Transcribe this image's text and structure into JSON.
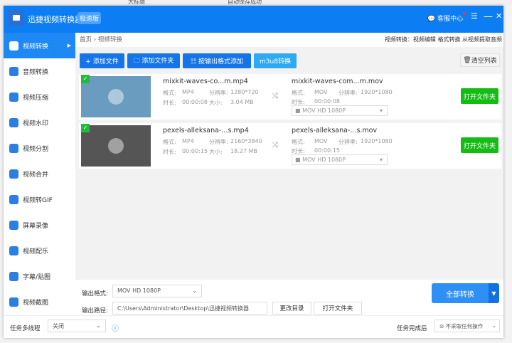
{
  "background": {
    "tab_title": "大标题",
    "autosave": "自动保存成功"
  },
  "app": {
    "title": "迅捷视频转换器",
    "badge": "极速版",
    "service": "客服中心",
    "menu_icon": "☰",
    "min_icon": "—",
    "close_icon": "✕"
  },
  "sidebar": {
    "items": [
      {
        "label": "视频转换"
      },
      {
        "label": "音频转换"
      },
      {
        "label": "视频压缩"
      },
      {
        "label": "视频水印"
      },
      {
        "label": "视频分割"
      },
      {
        "label": "视频合并"
      },
      {
        "label": "视频转GIF"
      },
      {
        "label": "屏幕录像"
      },
      {
        "label": "视频配乐"
      },
      {
        "label": "字幕/贴图"
      },
      {
        "label": "视频截图"
      }
    ]
  },
  "breadcrumb": {
    "home": "首页",
    "sep": "›",
    "current": "视频转换",
    "right": "视频转换：视频编辑 格式转换 从视频提取音频"
  },
  "toolbar": {
    "add_file": "+ 添加文件",
    "add_folder": "🗀 添加文件夹",
    "add_by_format": "☷ 按输出格式添加",
    "m3u8": "m3u8转换",
    "clear": "清空列表"
  },
  "files": [
    {
      "src_name": "mixkit-waves-co...m.mp4",
      "src_format": "MP4",
      "src_res": "1280*720",
      "src_dur": "00:00:08",
      "src_size": "3.04 MB",
      "dst_name": "mixkit-waves-com...m.mov",
      "dst_format": "MOV",
      "dst_res": "1920*1080",
      "dst_dur": "00:00:08",
      "dst_preset": "MOV  HD 1080P",
      "open": "打开文件夹",
      "thumb_color": "#6a9cc0"
    },
    {
      "src_name": "pexels-alleksana-...s.mp4",
      "src_format": "MP4",
      "src_res": "2160*3840",
      "src_dur": "00:00:15",
      "src_size": "18.27 MB",
      "dst_name": "pexels-alleksana-...s.mov",
      "dst_format": "MOV",
      "dst_res": "1920*1080",
      "dst_dur": "00:00:15",
      "dst_preset": "MOV  HD 1080P",
      "open": "打开文件夹",
      "thumb_color": "#555555"
    }
  ],
  "labels": {
    "format": "格式:",
    "resolution": "分辨率:",
    "duration": "时长:",
    "size": "大小:"
  },
  "output": {
    "format_label": "输出格式:",
    "format_value": "MOV  HD 1080P",
    "path_label": "输出路径:",
    "path_value": "C:\\Users\\Administrator\\Desktop\\迅捷视频转换器",
    "change_dir": "更改目录",
    "open_folder": "打开文件夹",
    "convert_all": "全部转换"
  },
  "footer": {
    "multithread_label": "任务多线程",
    "multithread_value": "关闭",
    "after_label": "任务完成后",
    "after_value": "⊘ 不采取任何操作"
  }
}
